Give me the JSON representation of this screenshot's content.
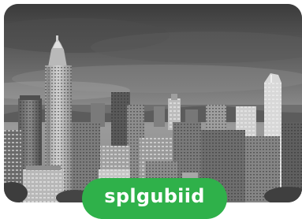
{
  "hero": {
    "image_icon": "city-skyline-photo",
    "accent_color": "#2fb14a"
  },
  "cta": {
    "label": "splgubiid"
  }
}
